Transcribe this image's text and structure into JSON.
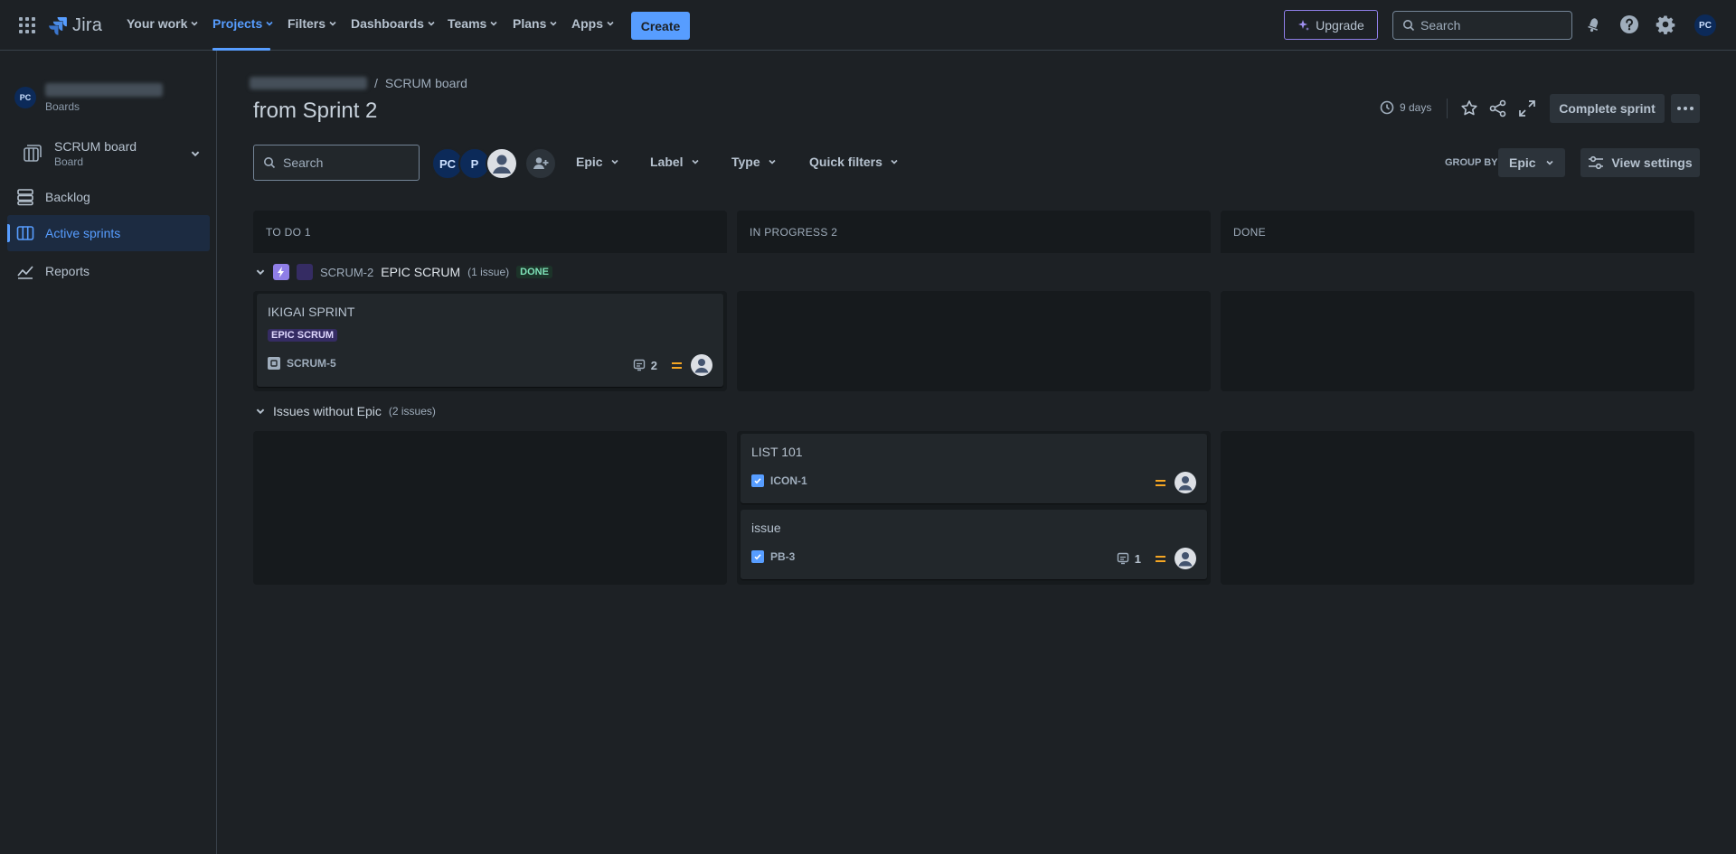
{
  "nav": {
    "product": "Jira",
    "items": [
      {
        "label": "Your work"
      },
      {
        "label": "Projects"
      },
      {
        "label": "Filters"
      },
      {
        "label": "Dashboards"
      },
      {
        "label": "Teams"
      },
      {
        "label": "Plans"
      },
      {
        "label": "Apps"
      }
    ],
    "create_label": "Create",
    "upgrade_label": "Upgrade",
    "search_placeholder": "Search",
    "user_initials": "PC"
  },
  "sidebar": {
    "project_avatar": "PC",
    "project_sub": "Boards",
    "board_name": "SCRUM board",
    "board_sub": "Board",
    "items": [
      {
        "label": "Backlog"
      },
      {
        "label": "Active sprints"
      },
      {
        "label": "Reports"
      }
    ]
  },
  "header": {
    "breadcrumb": "SCRUM board",
    "title": "from Sprint 2",
    "days_left": "9 days",
    "complete_label": "Complete sprint"
  },
  "toolbar": {
    "search_placeholder": "Search",
    "avatars": [
      "PC",
      "P"
    ],
    "filters": [
      "Epic",
      "Label",
      "Type",
      "Quick filters"
    ],
    "group_by_label": "GROUP BY",
    "group_by_value": "Epic",
    "view_settings_label": "View settings"
  },
  "columns": [
    {
      "title": "TO DO 1"
    },
    {
      "title": "IN PROGRESS 2"
    },
    {
      "title": "DONE"
    }
  ],
  "swimlanes": [
    {
      "key": "SCRUM-2",
      "name": "EPIC SCRUM",
      "count": "(1 issue)",
      "status": "DONE"
    },
    {
      "name": "Issues without Epic",
      "count": "(2 issues)"
    }
  ],
  "cards": [
    {
      "title": "IKIGAI SPRINT",
      "epic": "EPIC SCRUM",
      "key": "SCRUM-5",
      "subtasks": "2"
    },
    {
      "title": "LIST 101",
      "key": "ICON-1"
    },
    {
      "title": "issue",
      "key": "PB-3",
      "subtasks": "1"
    }
  ],
  "colors": {
    "accent": "#579dff",
    "background": "#1d2125",
    "column": "#161a1d",
    "card": "#22272b",
    "priority_medium": "#f5a623",
    "epic_purple": "#9f8fef",
    "done_green": "#4bce97"
  }
}
